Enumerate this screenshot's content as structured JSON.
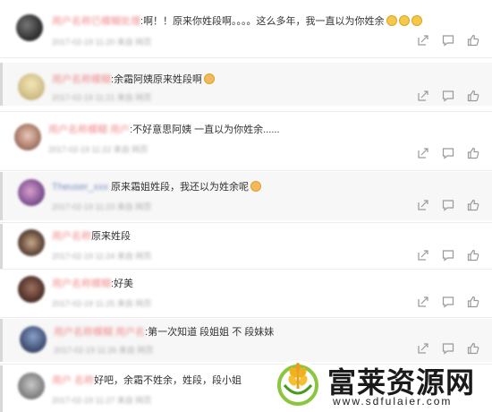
{
  "comments": [
    {
      "user": "用户名称已模糊处理",
      "text": "啊！！原来你姓段啊。。。。这么多年，我一直以为你姓余",
      "emojis": 3,
      "meta": "2017-02-19 11:20 来自 网页"
    },
    {
      "user": "用户名称模糊",
      "text": "余霜阿姨原来姓段啊",
      "emojis": 1,
      "meta": "2017-02-19 11:21 来自 网页"
    },
    {
      "user": "用户名称模糊 用户",
      "text": "不好意思阿姨 一直以为你姓余......",
      "emojis": 0,
      "meta": "2017-02-19 11:22 来自 网页"
    },
    {
      "user": "Theuser_xxx",
      "text": "原来霜姐姓段，我还以为姓余呢",
      "emojis": 1,
      "meta": "2017-02-19 11:23 来自 网页"
    },
    {
      "user": "用户名称",
      "text": "原来姓段",
      "emojis": 0,
      "meta": "2017-02-19 11:24 来自 网页"
    },
    {
      "user": "用户名称模糊",
      "text": "好美",
      "emojis": 0,
      "meta": "2017-02-19 11:25 来自 网页"
    },
    {
      "user": "用户名称模糊 用户名",
      "text": "第一次知道 段姐姐 不 段妹妹",
      "emojis": 0,
      "meta": "2017-02-19 11:26 来自 网页"
    },
    {
      "user": "用户 名称",
      "text": "好吧，余霜不姓余，姓段，段小姐",
      "emojis": 0,
      "meta": "2017-02-19 11:27 来自 网页"
    }
  ],
  "actions": {
    "share_icon": "share-icon",
    "comment_icon": "comment-icon",
    "like_icon": "like-icon"
  },
  "watermark": {
    "title": "富莱资源网",
    "url": "www.sdfulaier.com"
  },
  "colors": {
    "username": "#f08a8a",
    "text": "#333333",
    "meta": "#aaaaaa",
    "icon": "#9a9a9a"
  }
}
